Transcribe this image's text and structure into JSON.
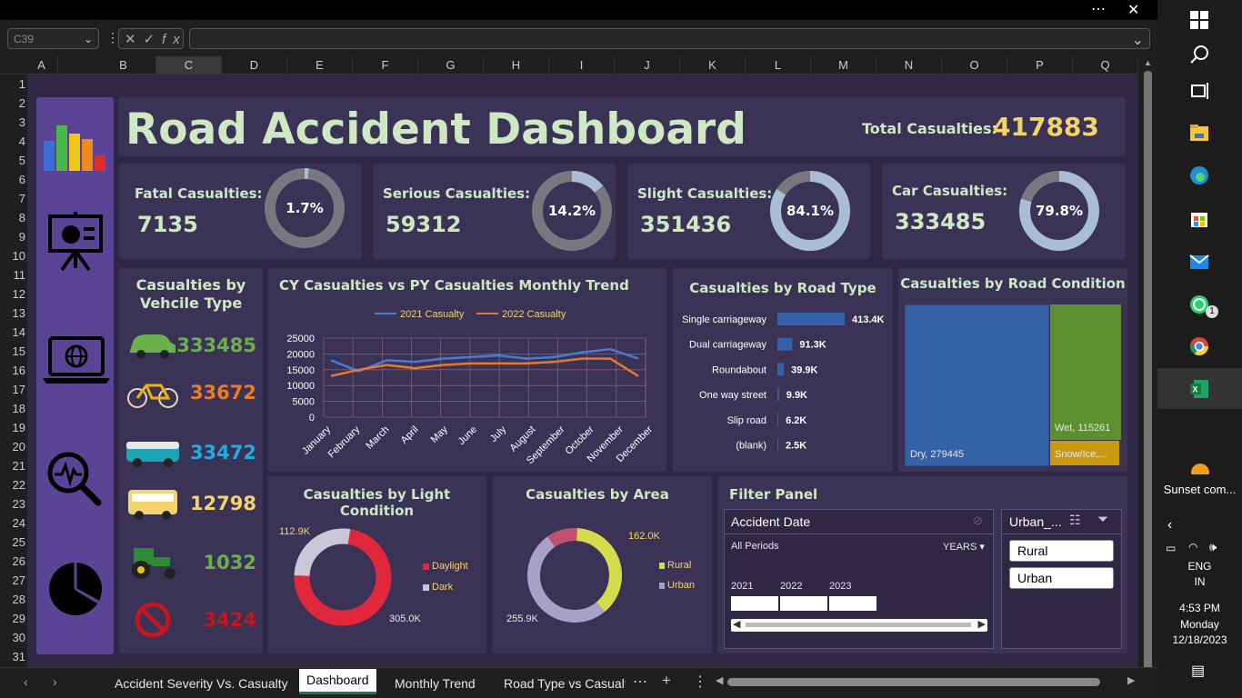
{
  "name_box": "C39",
  "columns": [
    "A",
    "B",
    "C",
    "D",
    "E",
    "F",
    "G",
    "H",
    "I",
    "J",
    "K",
    "L",
    "M",
    "N",
    "O",
    "P",
    "Q"
  ],
  "rows": [
    "1",
    "2",
    "3",
    "4",
    "5",
    "6",
    "7",
    "8",
    "9",
    "10",
    "11",
    "12",
    "13",
    "14",
    "15",
    "16",
    "17",
    "18",
    "19",
    "20",
    "21",
    "22",
    "23",
    "24",
    "25",
    "26",
    "27",
    "28",
    "29",
    "30",
    "31"
  ],
  "dashboard": {
    "title": "Road Accident Dashboard",
    "total_label": "Total Casualties:",
    "total_value": "417883",
    "kpis": [
      {
        "label": "Fatal Casualties:",
        "value": "7135",
        "pct": "1.7%",
        "fraction": 0.017
      },
      {
        "label": "Serious Casualties:",
        "value": "59312",
        "pct": "14.2%",
        "fraction": 0.142
      },
      {
        "label": "Slight Casualties:",
        "value": "351436",
        "pct": "84.1%",
        "fraction": 0.841
      },
      {
        "label": "Car Casualties:",
        "value": "333485",
        "pct": "79.8%",
        "fraction": 0.798
      }
    ],
    "vehicle": {
      "title1": "Casualties by",
      "title2": "Vehcile Type",
      "items": [
        {
          "icon": "car-icon",
          "value": "333485",
          "color": "#6ab04c"
        },
        {
          "icon": "bicycle-icon",
          "value": "33672",
          "color": "#ee7b22"
        },
        {
          "icon": "van-icon",
          "value": "33472",
          "color": "#1aaee5"
        },
        {
          "icon": "bus-icon",
          "value": "12798",
          "color": "#f5d36b"
        },
        {
          "icon": "tractor-icon",
          "value": "1032",
          "color": "#6ab04c"
        },
        {
          "icon": "other-vehicle-icon",
          "value": "3424",
          "color": "#c4161c"
        }
      ]
    },
    "light": {
      "title": "Casualties by Light Condition",
      "legend": [
        "Daylight",
        "Dark"
      ],
      "labels": [
        "112.9K",
        "305.0K"
      ],
      "colors": [
        "#e0273c",
        "#c9c7d8"
      ]
    },
    "area": {
      "title": "Casualties by Area",
      "legend": [
        "Rural",
        "Urban"
      ],
      "labels": [
        "162.0K",
        "255.9K"
      ],
      "colors": [
        "#d4dc4c",
        "#a8a0c8"
      ]
    },
    "filter": {
      "title": "Filter Panel",
      "slicer_title": "Accident Date",
      "periods": "All Periods",
      "unit": "YEARS",
      "years": [
        "2021",
        "2022",
        "2023"
      ],
      "area_slicer_title": "Urban_...",
      "area_options": [
        "Rural",
        "Urban"
      ]
    }
  },
  "chart_data": [
    {
      "type": "line",
      "title": "CY Casualties vs PY Casualties Monthly Trend",
      "x": [
        "January",
        "February",
        "March",
        "April",
        "May",
        "June",
        "July",
        "August",
        "September",
        "October",
        "November",
        "December"
      ],
      "series": [
        {
          "name": "2021 Casualty",
          "values": [
            18000,
            14500,
            18000,
            17500,
            18500,
            19000,
            19500,
            18500,
            19000,
            20500,
            21500,
            18500
          ]
        },
        {
          "name": "2022 Casualty",
          "values": [
            13000,
            15000,
            16500,
            15500,
            16500,
            17000,
            17000,
            17000,
            17500,
            18500,
            18500,
            13000
          ]
        }
      ],
      "ylim": [
        0,
        25000
      ],
      "yticks": [
        "25000",
        "20000",
        "15000",
        "10000",
        "5000",
        "0"
      ],
      "colors": [
        "#4a7bd0",
        "#e8782a"
      ]
    },
    {
      "type": "bar",
      "title": "Casualties by Road Type",
      "categories": [
        "Single carriageway",
        "Dual carriageway",
        "Roundabout",
        "One way street",
        "Slip road",
        "(blank)"
      ],
      "values": [
        413.4,
        91.3,
        39.9,
        9.9,
        6.2,
        2.5
      ],
      "labels": [
        "413.4K",
        "91.3K",
        "39.9K",
        "9.9K",
        "6.2K",
        "2.5K"
      ]
    },
    {
      "type": "heatmap",
      "title": "Casualties by Road Condition",
      "categories": [
        "Dry",
        "Wet",
        "Snow/Ice"
      ],
      "values": [
        279445,
        115261,
        null
      ],
      "labels": [
        "Dry, 279445",
        "Wet, 115261",
        "Snow/Ice,..."
      ]
    }
  ],
  "sheet_tabs": [
    "Accident Severity Vs. Casualty",
    "Dashboard",
    "Monthly Trend",
    "Road Type vs Casualty"
  ],
  "taskbar": {
    "weather": "Sunset com...",
    "lang1": "ENG",
    "lang2": "IN",
    "time": "4:53 PM",
    "day": "Monday",
    "date": "12/18/2023",
    "whatsapp_badge": "1"
  }
}
